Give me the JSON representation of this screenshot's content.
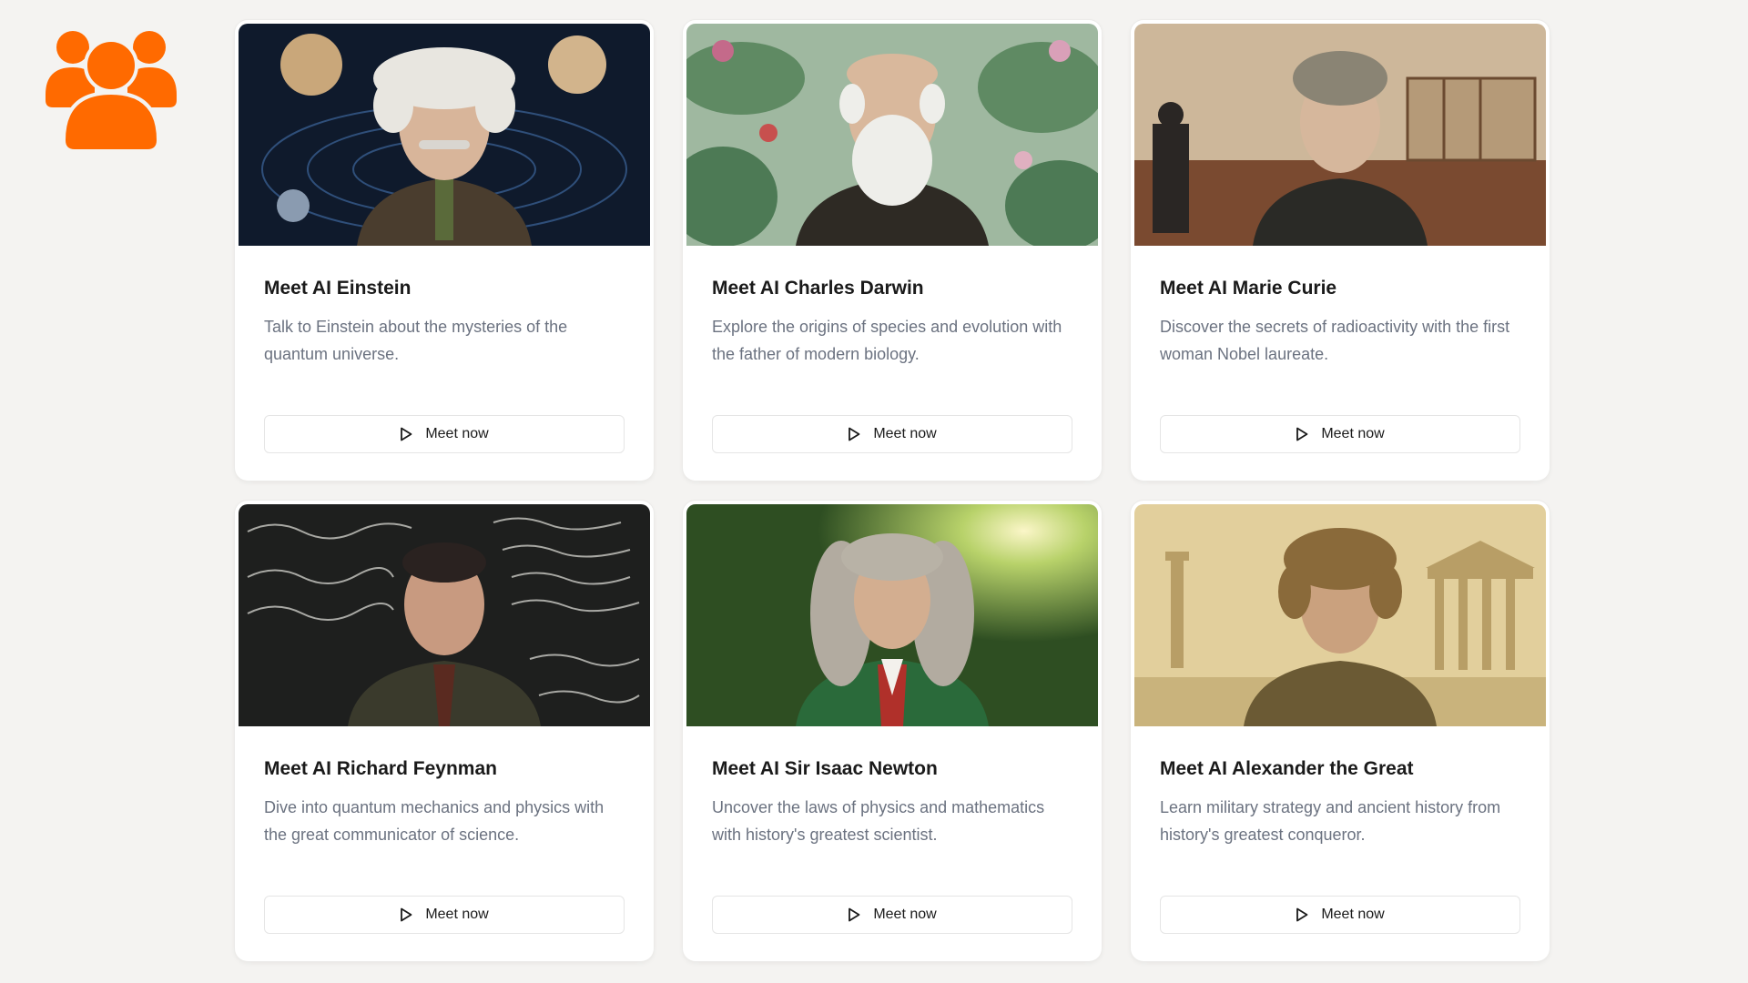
{
  "brand": {
    "logo_icon": "group-users-icon",
    "color": "#ff6a00"
  },
  "cards": [
    {
      "title": "Meet AI Einstein",
      "description": "Talk to Einstein about the mysteries of the quantum universe.",
      "button_label": "Meet now",
      "button_icon": "play-icon",
      "image_theme": "space-planets"
    },
    {
      "title": "Meet AI Charles Darwin",
      "description": "Explore the origins of species and evolution with the father of modern biology.",
      "button_label": "Meet now",
      "button_icon": "play-icon",
      "image_theme": "botanical-birds"
    },
    {
      "title": "Meet AI Marie Curie",
      "description": "Discover the secrets of radioactivity with the first woman Nobel laureate.",
      "button_label": "Meet now",
      "button_icon": "play-icon",
      "image_theme": "laboratory"
    },
    {
      "title": "Meet AI Richard Feynman",
      "description": "Dive into quantum mechanics and physics with the great communicator of science.",
      "button_label": "Meet now",
      "button_icon": "play-icon",
      "image_theme": "chalkboard"
    },
    {
      "title": "Meet AI Sir Isaac Newton",
      "description": "Uncover the laws of physics and mathematics with history's greatest scientist.",
      "button_label": "Meet now",
      "button_icon": "play-icon",
      "image_theme": "forest-sunlight"
    },
    {
      "title": "Meet AI Alexander the Great",
      "description": "Learn military strategy and ancient history from history's greatest conqueror.",
      "button_label": "Meet now",
      "button_icon": "play-icon",
      "image_theme": "ancient-greece"
    }
  ]
}
